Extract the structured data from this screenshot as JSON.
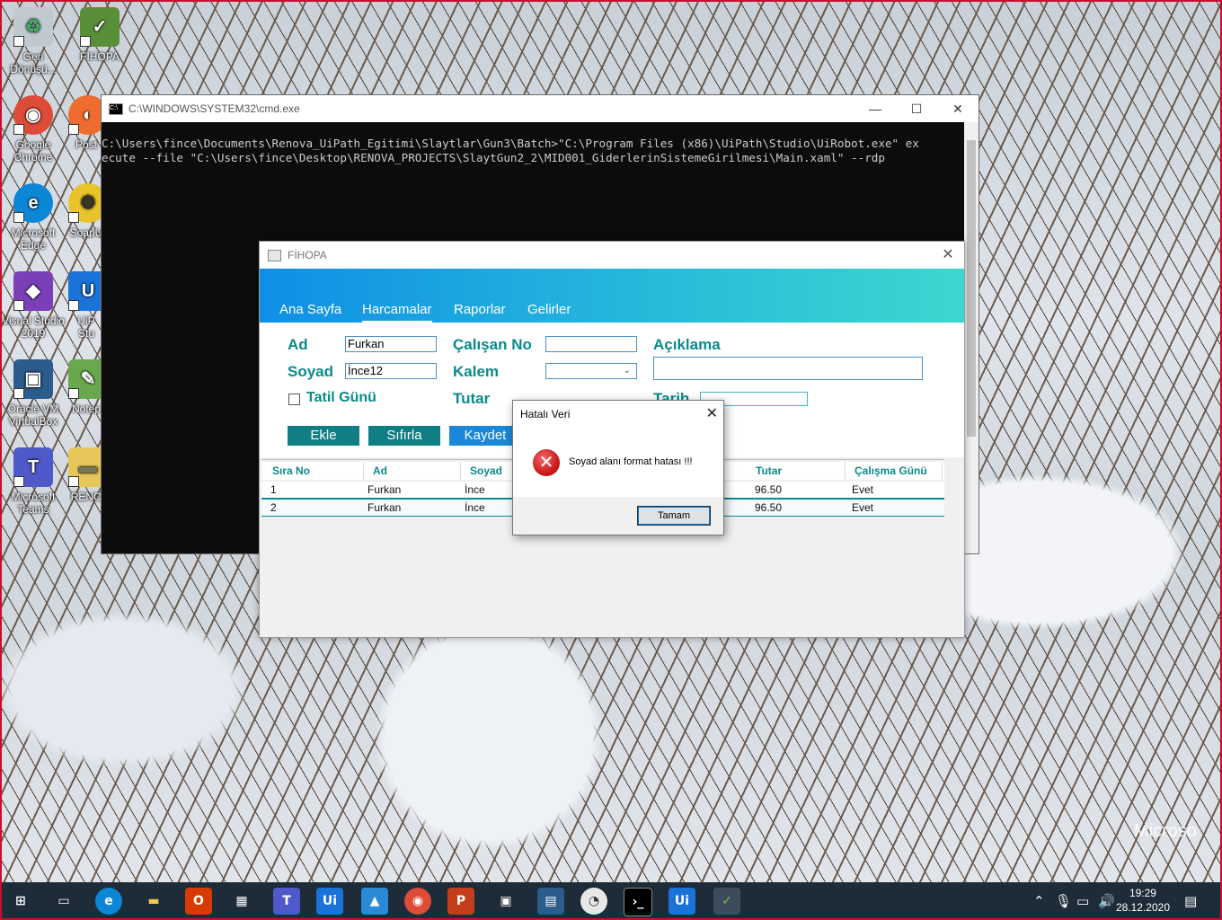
{
  "desktop": {
    "icons": [
      {
        "label": "Geri Dönüşü...",
        "glyph": "♻",
        "color": "#c0c8d0"
      },
      {
        "label": "FIHOPA",
        "glyph": "✓",
        "color": "#5a8f3a"
      },
      {
        "label": "Google Chrome",
        "glyph": "◉",
        "color": "#dd4b39"
      },
      {
        "label": "Post",
        "glyph": "◐",
        "color": "#ef6c30"
      },
      {
        "label": "Microsoft Edge",
        "glyph": "e",
        "color": "#0b87d6"
      },
      {
        "label": "SoapU",
        "glyph": "⚙",
        "color": "#e8c42a"
      },
      {
        "label": "Visual Studio 2019",
        "glyph": "◆",
        "color": "#7b3fb8"
      },
      {
        "label": "UiP Stu",
        "glyph": "U",
        "color": "#1a73d9"
      },
      {
        "label": "Oracle VM VirtualBox",
        "glyph": "▣",
        "color": "#2b5c8c"
      },
      {
        "label": "Notep",
        "glyph": "✎",
        "color": "#6aa84f"
      },
      {
        "label": "Microsoft Teams",
        "glyph": "T",
        "color": "#5059c9"
      },
      {
        "label": "RENO",
        "glyph": "▬",
        "color": "#e8c75a"
      }
    ],
    "watermark": "Microso"
  },
  "cmd_window": {
    "title": "C:\\WINDOWS\\SYSTEM32\\cmd.exe",
    "lines": [
      "C:\\Users\\fince\\Documents\\Renova_UiPath_Egitimi\\Slaytlar\\Gun3\\Batch>\"C:\\Program Files (x86)\\UiPath\\Studio\\UiRobot.exe\" ex",
      "ecute --file \"C:\\Users\\fince\\Desktop\\RENOVA_PROJECTS\\SlaytGun2_2\\MID001_GiderlerinSistemeGirilmesi\\Main.xaml\" --rdp"
    ]
  },
  "app_window": {
    "title": "FİHOPA",
    "tabs": [
      "Ana Sayfa",
      "Harcamalar",
      "Raporlar",
      "Gelirler"
    ],
    "active_tab": "Harcamalar",
    "form": {
      "ad_label": "Ad",
      "ad_value": "Furkan",
      "soyad_label": "Soyad",
      "soyad_value": "İnce12",
      "tatil_label": "Tatil Günü",
      "calisan_label": "Çalışan No",
      "calisan_value": "",
      "kalem_label": "Kalem",
      "tutar_label": "Tutar",
      "aciklama_label": "Açıklama",
      "tarih_label": "Tarih"
    },
    "buttons": {
      "ekle": "Ekle",
      "sifirla": "Sıfırla",
      "kaydet": "Kaydet"
    },
    "grid": {
      "columns": [
        "Sıra No",
        "Ad",
        "Soyad",
        "Tutar",
        "Çalışma Günü"
      ],
      "rows": [
        {
          "sira": "1",
          "ad": "Furkan",
          "soyad": "İnce",
          "tutar": "96.50",
          "calisma": "Evet"
        },
        {
          "sira": "2",
          "ad": "Furkan",
          "soyad": "İnce",
          "tutar": "96.50",
          "calisma": "Evet"
        }
      ]
    }
  },
  "dialog": {
    "title": "Hatalı Veri",
    "message": "Soyad alanı format hatası !!!",
    "ok_label": "Tamam",
    "icon": "error-icon"
  },
  "taskbar": {
    "time": "19:29",
    "date": "28.12.2020"
  },
  "colors": {
    "accent_teal": "#0a8a8a",
    "button_teal": "#0f7f83",
    "button_blue": "#1a87d9"
  }
}
